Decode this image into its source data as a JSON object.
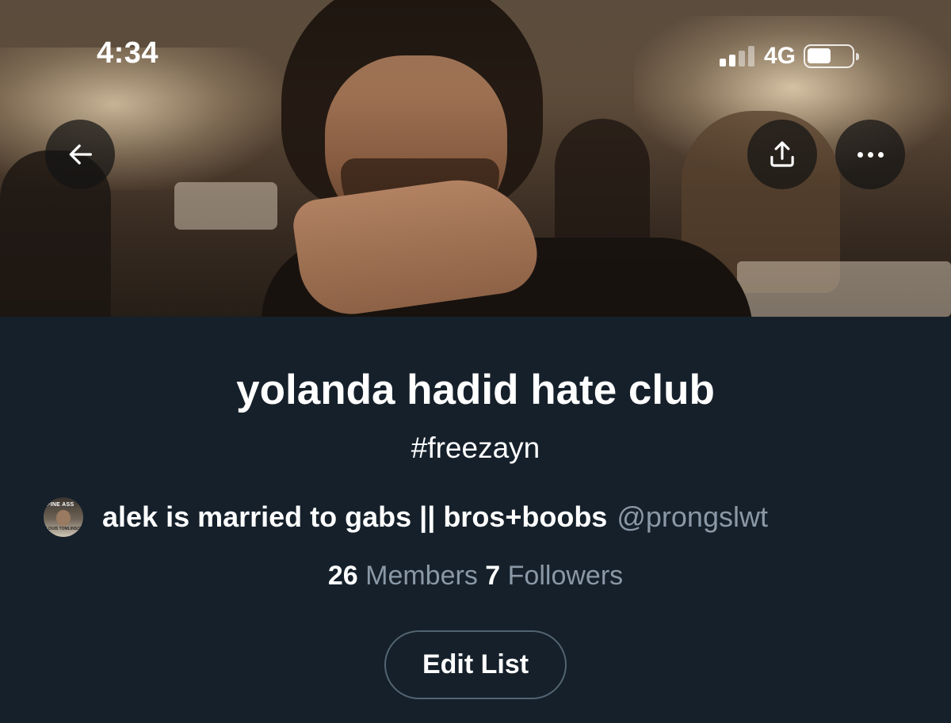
{
  "status_bar": {
    "time": "4:34",
    "network": "4G",
    "battery_level": 0.55,
    "signal_bars": 2
  },
  "banner": {
    "back_icon": "arrow-left-icon",
    "share_icon": "share-icon",
    "more_icon": "more-horizontal-icon"
  },
  "list": {
    "name": "yolanda hadid hate club",
    "description": "#freezayn",
    "owner": {
      "avatar_top": "FINE ASS",
      "avatar_bottom": "LOUIS TOMLINSON",
      "display_name": "alek is married to gabs || bros+boobs",
      "handle": "@prongslwt"
    },
    "stats": {
      "members_count": "26",
      "members_label": "Members",
      "followers_count": "7",
      "followers_label": "Followers"
    },
    "edit_button_label": "Edit List"
  },
  "colors": {
    "background": "#15202b",
    "text_primary": "#ffffff",
    "text_secondary": "#8b98a5",
    "button_border": "#536471"
  }
}
